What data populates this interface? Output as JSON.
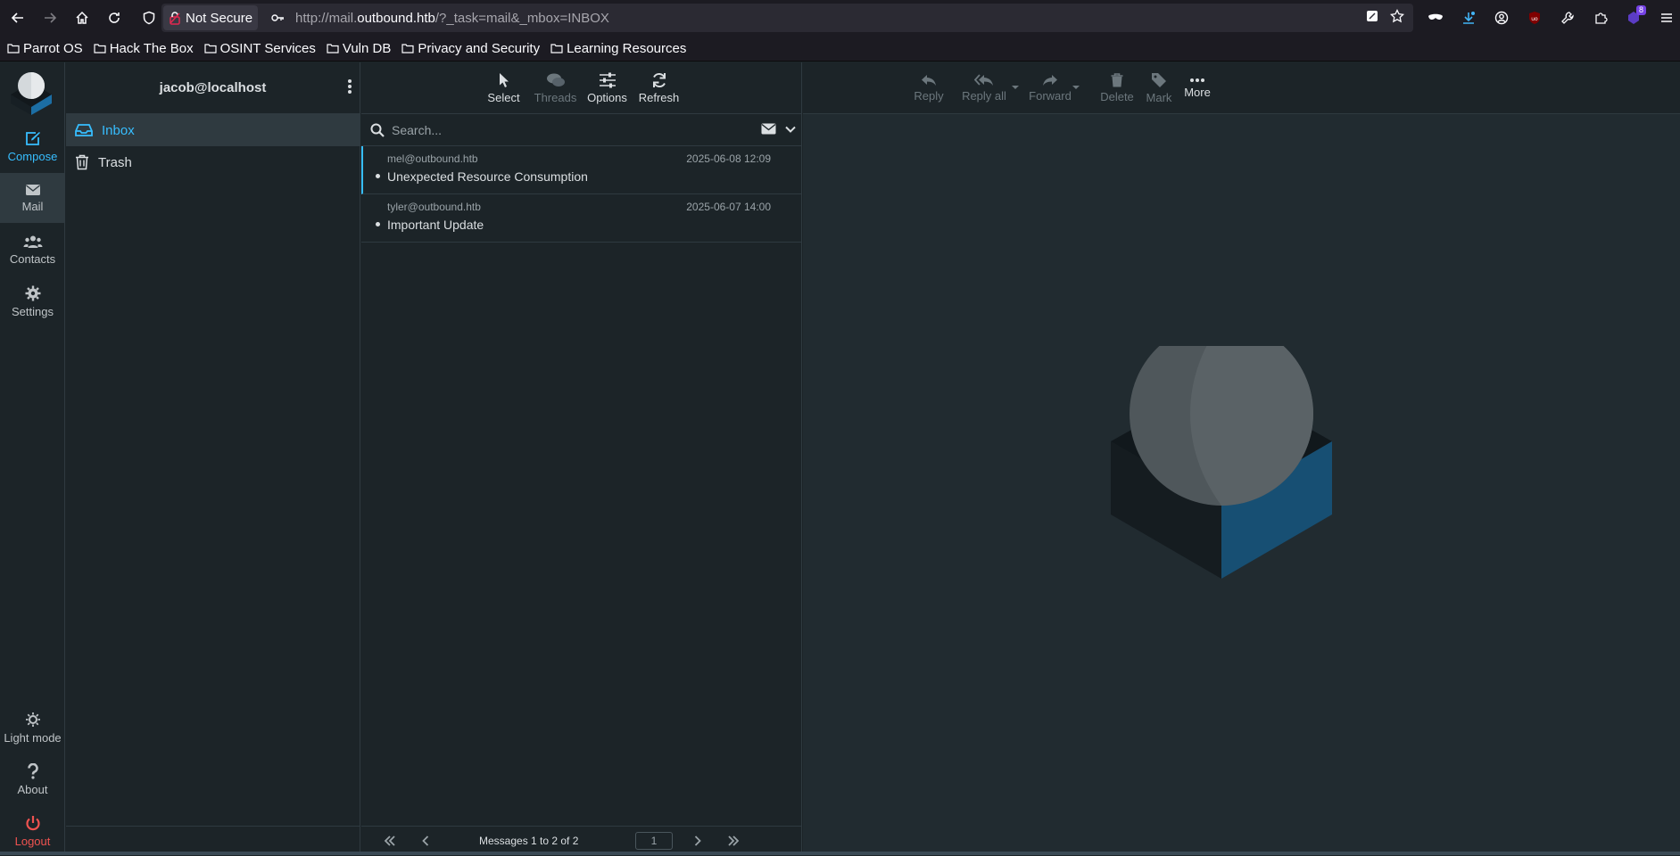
{
  "browser": {
    "security_label": "Not Secure",
    "url_prefix": "http://mail.",
    "url_host": "outbound.htb",
    "url_suffix": "/?_task=mail&_mbox=INBOX",
    "extension_badge": "8",
    "bookmarks": [
      "Parrot OS",
      "Hack The Box",
      "OSINT Services",
      "Vuln DB",
      "Privacy and Security",
      "Learning Resources"
    ]
  },
  "taskmenu": {
    "compose": "Compose",
    "mail": "Mail",
    "contacts": "Contacts",
    "settings": "Settings",
    "light_mode": "Light mode",
    "about": "About",
    "logout": "Logout"
  },
  "folders": {
    "account": "jacob@localhost",
    "items": [
      {
        "label": "Inbox"
      },
      {
        "label": "Trash"
      }
    ]
  },
  "list_toolbar": {
    "select": "Select",
    "threads": "Threads",
    "options": "Options",
    "refresh": "Refresh"
  },
  "search": {
    "placeholder": "Search..."
  },
  "messages": [
    {
      "from": "mel@outbound.htb",
      "date": "2025-06-08 12:09",
      "subject": "Unexpected Resource Consumption"
    },
    {
      "from": "tyler@outbound.htb",
      "date": "2025-06-07 14:00",
      "subject": "Important Update"
    }
  ],
  "pager": {
    "count_text": "Messages 1 to 2 of 2",
    "page": "1"
  },
  "content_toolbar": {
    "reply": "Reply",
    "reply_all": "Reply all",
    "forward": "Forward",
    "delete": "Delete",
    "mark": "Mark",
    "more": "More"
  },
  "colors": {
    "accent": "#37beff",
    "logout": "#ef5350",
    "background": "#1c2428"
  }
}
